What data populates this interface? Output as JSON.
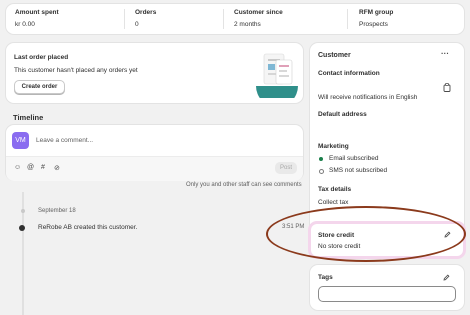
{
  "stats": [
    {
      "label": "Amount spent",
      "value": "kr 0.00"
    },
    {
      "label": "Orders",
      "value": "0"
    },
    {
      "label": "Customer since",
      "value": "2 months"
    },
    {
      "label": "RFM group",
      "value": "Prospects"
    }
  ],
  "last_order": {
    "title": "Last order placed",
    "message": "This customer hasn't placed any orders yet",
    "button": "Create order"
  },
  "timeline": {
    "title": "Timeline",
    "avatar_initials": "VM",
    "comment_placeholder": "Leave a comment...",
    "post_label": "Post",
    "note": "Only you and other staff can see comments",
    "date": "September 18",
    "event": "ReRobe AB created this customer.",
    "time": "3:51 PM",
    "icons": [
      "emoji-icon",
      "mention-icon",
      "hashtag-icon",
      "attachment-icon"
    ]
  },
  "customer": {
    "title": "Customer",
    "more": "···",
    "contact_title": "Contact information",
    "notifications": "Will receive notifications in English",
    "address_title": "Default address",
    "marketing_title": "Marketing",
    "email_status": "Email subscribed",
    "sms_status": "SMS not subscribed",
    "tax_title": "Tax details",
    "tax_value": "Collect tax"
  },
  "store_credit": {
    "title": "Store credit",
    "value": "No store credit"
  },
  "tags": {
    "title": "Tags",
    "input_value": ""
  },
  "colors": {
    "highlight_ring": "#8b3a1c",
    "highlight_glow": "#f4d6ec",
    "avatar": "#8a6cf0"
  }
}
